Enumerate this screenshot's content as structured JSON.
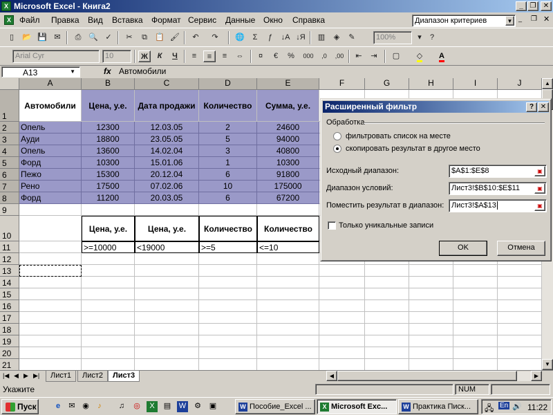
{
  "window": {
    "title": "Microsoft Excel - Книга2"
  },
  "menu": {
    "items": [
      "Файл",
      "Правка",
      "Вид",
      "Вставка",
      "Формат",
      "Сервис",
      "Данные",
      "Окно",
      "Справка"
    ],
    "named_range": "Диапазон критериев"
  },
  "toolbar": {
    "zoom": "100%",
    "font_name": "Arial Cyr",
    "font_size": "10",
    "bold": "Ж",
    "italic": "К",
    "underline": "Ч",
    "thousands": "000"
  },
  "formula_bar": {
    "cell_ref": "A13",
    "fx": "fx",
    "value": "Автомобили"
  },
  "columns": [
    "A",
    "B",
    "C",
    "D",
    "E",
    "F",
    "G",
    "H",
    "I",
    "J"
  ],
  "rows": [
    "1",
    "2",
    "3",
    "4",
    "5",
    "6",
    "7",
    "8",
    "9",
    "10",
    "11",
    "12",
    "13",
    "14",
    "15",
    "16",
    "17",
    "18",
    "19",
    "20",
    "21"
  ],
  "table": {
    "headers": [
      "Автомобили",
      "Цена, у.е.",
      "Дата продажи",
      "Количество",
      "Сумма, у.е."
    ],
    "rows": [
      [
        "Опель",
        "12300",
        "12.03.05",
        "2",
        "24600"
      ],
      [
        "Ауди",
        "18800",
        "23.05.05",
        "5",
        "94000"
      ],
      [
        "Опель",
        "13600",
        "14.02.04",
        "3",
        "40800"
      ],
      [
        "Форд",
        "10300",
        "15.01.06",
        "1",
        "10300"
      ],
      [
        "Пежо",
        "15300",
        "20.12.04",
        "6",
        "91800"
      ],
      [
        "Рено",
        "17500",
        "07.02.06",
        "10",
        "175000"
      ],
      [
        "Форд",
        "11200",
        "20.03.05",
        "6",
        "67200"
      ]
    ]
  },
  "criteria": {
    "headers": [
      "Цена, у.е.",
      "Цена, у.е.",
      "Количество",
      "Количество"
    ],
    "values": [
      ">=10000",
      "<19000",
      ">=5",
      "<=10"
    ]
  },
  "sheets": [
    "Лист1",
    "Лист2",
    "Лист3"
  ],
  "status": {
    "text": "Укажите",
    "num": "NUM"
  },
  "taskbar": {
    "start": "Пуск",
    "buttons": [
      "Пособие_Excel ...",
      "Microsoft Exc...",
      "Практика Писк..."
    ],
    "lang": "En",
    "clock": "11:22"
  },
  "dialog": {
    "title": "Расширенный фильтр",
    "help": "?",
    "group_label": "Обработка",
    "radio_filter_in_place": "фильтровать список на месте",
    "radio_copy_to": "скопировать результат в другое место",
    "copy_to_selected": true,
    "source_label": "Исходный диапазон:",
    "source_value": "$A$1:$E$8",
    "criteria_label": "Диапазон условий:",
    "criteria_value": "Лист3!$B$10:$E$11",
    "dest_label": "Поместить результат в диапазон:",
    "dest_value": "Лист3!$A$13",
    "unique_label": "Только уникальные записи",
    "ok": "OK",
    "cancel": "Отмена"
  }
}
